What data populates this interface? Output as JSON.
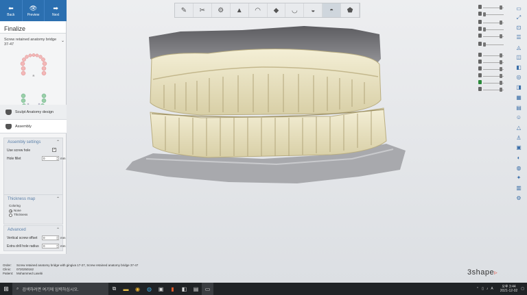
{
  "nav": {
    "back": "Back",
    "preview": "Preview",
    "next": "Next"
  },
  "panel": {
    "title": "Finalize",
    "restoration_type": "Screw retained anatomy bridge 37-47",
    "steps": [
      "Sculpt Anatomy design",
      "Assembly"
    ]
  },
  "assembly": {
    "header": "Assembly settings",
    "use_screw_hole_label": "Use screw hole",
    "use_screw_hole": "✓",
    "hole_fillet_label": "Hole fillet",
    "hole_fillet_value": "0",
    "unit": "mm"
  },
  "thickness": {
    "header": "Thickness map",
    "coloring_label": "Coloring",
    "options": [
      "None",
      "Thickness"
    ],
    "selected": "None"
  },
  "advanced": {
    "header": "Advanced",
    "vso_label": "Vertical screw offset",
    "vso_value": "0",
    "edhr_label": "Extra drill hole radius",
    "edhr_value": "0",
    "unit": "mm"
  },
  "info": {
    "order_key": "Order:",
    "order_val": "Screw retained anatomy bridge with gingiva 17-27, Screw retained anatomy bridge 37-47",
    "clinic_key": "Clinic:",
    "clinic_val": "0720250162",
    "patient_key": "Patient:",
    "patient_val": "Mohammed Lasebi"
  },
  "logo": "3shape",
  "taskbar": {
    "search_placeholder": "검색하려면 여기에 입력하십시오.",
    "time": "오후 3:44",
    "date": "2021-12-02",
    "lang": "A"
  },
  "colors": {
    "accent": "#2b6fb0",
    "tooth": "#e9e3c4",
    "gingiva": "#8a8a8c",
    "logo_mark": "#e05a4a"
  }
}
